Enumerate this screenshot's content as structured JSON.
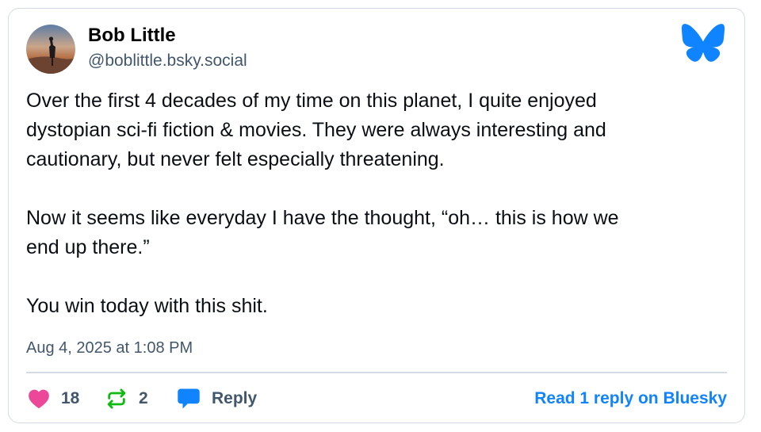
{
  "author": {
    "display_name": "Bob Little",
    "handle": "@boblittle.bsky.social"
  },
  "post": {
    "paragraphs": [
      [
        "Over the first 4 decades of my time on this planet, I quite enjoyed",
        "dystopian sci-fi fiction & movies. They were always interesting and",
        "cautionary, but never felt especially threatening."
      ],
      [
        "Now it seems like everyday I have the thought, “oh… this is how we",
        "end up there.”"
      ],
      [
        "You win today with this shit."
      ]
    ],
    "timestamp": "Aug 4, 2025 at 1:08 PM"
  },
  "actions": {
    "likes": "18",
    "reposts": "2",
    "reply_label": "Reply",
    "read_link": "Read 1 reply on Bluesky"
  },
  "icons": {
    "like": "heart-icon",
    "repost": "repost-icon",
    "reply": "speech-bubble-icon",
    "logo": "bluesky-butterfly-icon"
  },
  "colors": {
    "brand_blue": "#1083fe",
    "like_pink": "#ec4899",
    "repost_green": "#13b913",
    "muted_text": "#42576c",
    "border": "#d4dbe2"
  }
}
